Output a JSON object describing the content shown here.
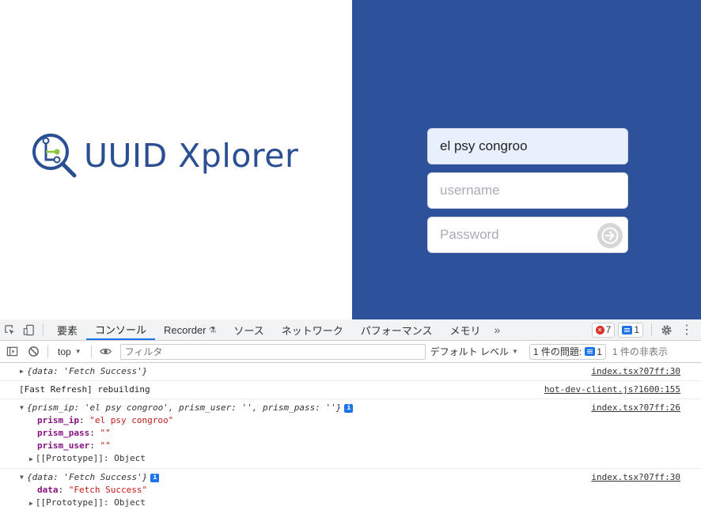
{
  "app": {
    "logo_text": "UUID Xplorer",
    "fields": {
      "prism_ip_value": "el psy congroo",
      "username_placeholder": "username",
      "password_placeholder": "Password"
    },
    "colors": {
      "panel": "#2e5299",
      "logo": "#2b4f93",
      "accent": "#8cc63f"
    }
  },
  "devtools": {
    "tabs": [
      "要素",
      "コンソール",
      "Recorder",
      "ソース",
      "ネットワーク",
      "パフォーマンス",
      "メモリ"
    ],
    "more_tabs_icon": "»",
    "error_count": "7",
    "message_count": "1",
    "context": "top",
    "filter_placeholder": "フィルタ",
    "levels": "デフォルト レベル",
    "issues_label": "1 件の問題:",
    "issues_count": "1",
    "hidden_label": "1 件の非表示",
    "messages": [
      {
        "text": "{data: 'Fetch Success'}",
        "source": "index.tsx?07ff:30"
      },
      {
        "text": "[Fast Refresh] rebuilding",
        "source": "hot-dev-client.js?1600:155"
      },
      {
        "text": "{prism_ip: 'el psy congroo', prism_user: '', prism_pass: ''}",
        "source": "index.tsx?07ff:26",
        "props": [
          {
            "key": "prism_ip",
            "val": "\"el psy congroo\""
          },
          {
            "key": "prism_pass",
            "val": "\"\""
          },
          {
            "key": "prism_user",
            "val": "\"\""
          }
        ],
        "proto": "[[Prototype]]: Object"
      },
      {
        "text": "{data: 'Fetch Success'}",
        "source": "index.tsx?07ff:30",
        "props": [
          {
            "key": "data",
            "val": "\"Fetch Success\""
          }
        ],
        "proto": "[[Prototype]]: Object"
      }
    ]
  }
}
